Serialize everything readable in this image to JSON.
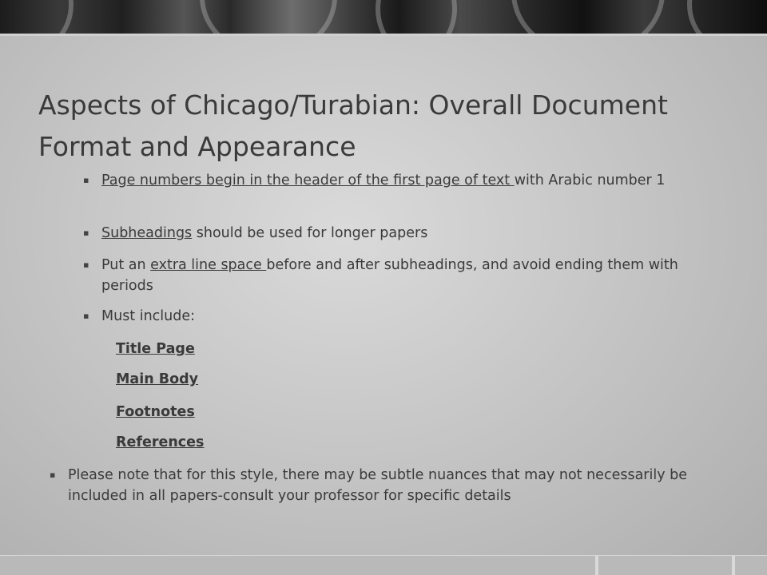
{
  "slide": {
    "title": "Aspects of Chicago/Turabian: Overall Document Format and Appearance",
    "bullet_marker": "▪",
    "bullets": [
      {
        "link": "Page numbers begin in the header of the first page of text ",
        "rest": "with Arabic number 1"
      },
      {
        "link": "Subheadings",
        "rest": " should be used for longer papers"
      },
      {
        "pre": "Put an ",
        "link": "extra line space ",
        "rest": "before and after subheadings, and avoid ending them with periods"
      },
      {
        "text": "Must include:"
      }
    ],
    "must_include": [
      "Title Page",
      "Main Body",
      "Footnotes",
      "References"
    ],
    "note": "Please note that for this style, there may  be subtle nuances that may not necessarily be included in all papers-consult your professor for specific details"
  }
}
